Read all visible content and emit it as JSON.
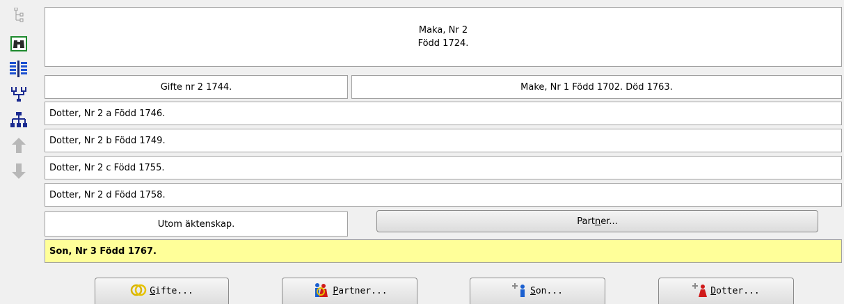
{
  "toolbar": {
    "icons": [
      "tree-icon",
      "binoculars-icon",
      "columns-icon",
      "pedigree-icon",
      "descendants-icon",
      "navigate-up-icon",
      "navigate-down-icon"
    ]
  },
  "main_person": {
    "line1": "Maka, Nr 2",
    "line2": "Född 1724."
  },
  "marriage": {
    "label": "Gifte nr 2 1744.",
    "spouse": "Make, Nr 1 Född 1702. Död 1763."
  },
  "children": [
    "Dotter, Nr 2 a Född 1746.",
    "Dotter, Nr 2 b Född 1749.",
    "Dotter, Nr 2 c Född 1755.",
    "Dotter, Nr 2 d Född 1758."
  ],
  "outside_marriage": {
    "label": "Utom äktenskap.",
    "partner_button_pre": "Part",
    "partner_button_u": "n",
    "partner_button_post": "er..."
  },
  "selected_child": "Son, Nr 3 Född 1767.",
  "buttons": {
    "gifte_u": "G",
    "gifte_rest": "ifte...",
    "partner_u": "P",
    "partner_rest": "artner...",
    "son_u": "S",
    "son_rest": "on...",
    "dotter_u": "D",
    "dotter_rest": "otter..."
  },
  "colors": {
    "selected_bg": "#ffff99",
    "male": "#1a5fd0",
    "female": "#d01a1a"
  }
}
